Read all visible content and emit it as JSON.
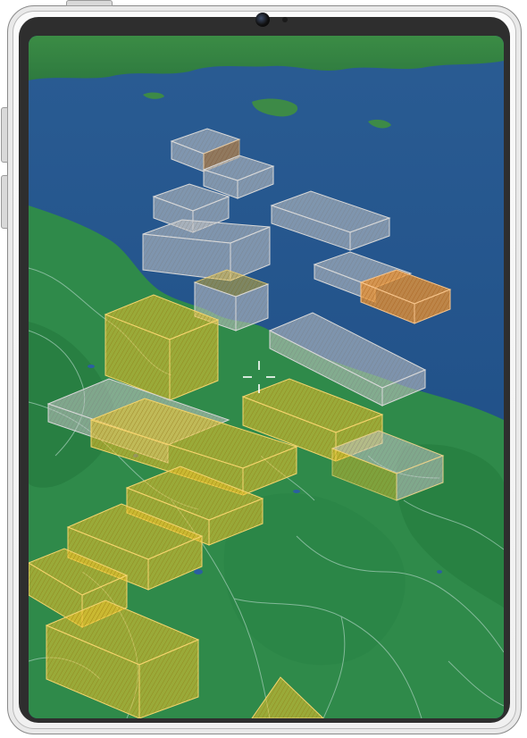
{
  "device": {
    "type": "tablet",
    "frame_color": "#f2f2f2",
    "bezel_color": "#2e2e2e"
  },
  "map": {
    "view": "3d-perspective",
    "layer": "satellite",
    "colors": {
      "sea": "#1f4f86",
      "land": "#2f8a4a",
      "land_dark": "#206a38",
      "borders": "#9fcab4",
      "volume_orange": "#f0a23a",
      "volume_yellow": "#f2c42c",
      "volume_grey": "#c9c9c9"
    },
    "overlay": {
      "type": "airspace-grid-volumes",
      "styles": [
        "restricted",
        "caution",
        "free"
      ]
    },
    "center_reticle": {
      "icon": "crosshair-icon",
      "color": "#ffffff"
    }
  }
}
